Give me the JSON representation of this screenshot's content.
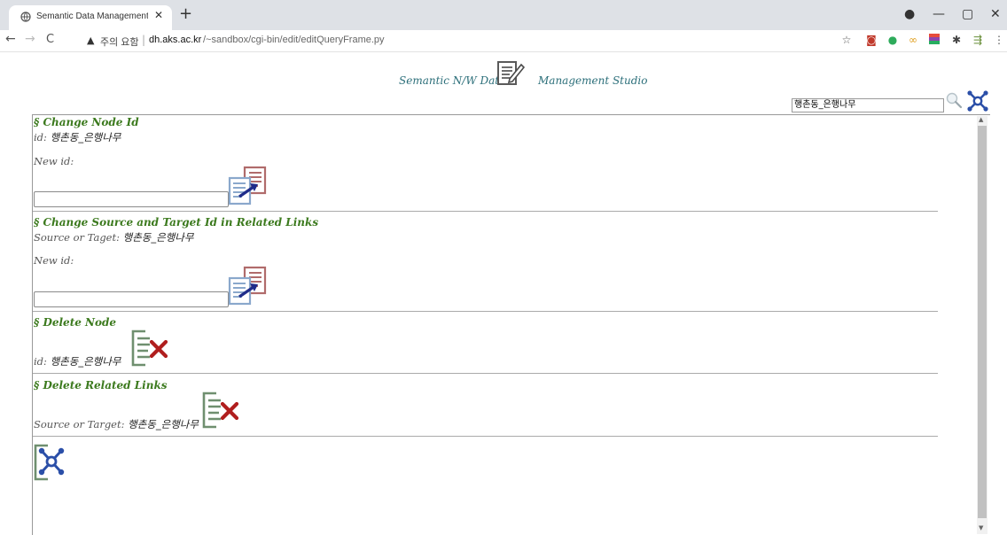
{
  "browser": {
    "tab_title": "Semantic Data Management St",
    "new_tab": "+",
    "address": {
      "security_label": "주의 요함",
      "separator": "|",
      "host": "dh.aks.ac.kr",
      "path": "/~sandbox/cgi-bin/edit/editQueryFrame.py"
    }
  },
  "header": {
    "title_left": "Semantic N/W Data",
    "title_right": "Management Studio",
    "search_value": "행촌동_은행나무"
  },
  "sections": {
    "change_node": {
      "title": "§ Change Node Id",
      "id_label": "id:",
      "id_value": "행촌동_은행나무",
      "new_id_label": "New id:",
      "new_id_value": ""
    },
    "change_links": {
      "title": "§ Change Source and Target Id in Related Links",
      "label": "Source or Taget:",
      "value": "행촌동_은행나무",
      "new_id_label": "New id:",
      "new_id_value": ""
    },
    "delete_node": {
      "title": "§ Delete Node",
      "id_label": "id:",
      "id_value": "행촌동_은행나무"
    },
    "delete_links": {
      "title": "§ Delete Related Links",
      "label": "Source or Target:",
      "value": "행촌동_은행나무"
    }
  },
  "colors": {
    "section_title": "#3c7a1e",
    "brand": "#2c6f7a",
    "delete_x": "#b01e1e",
    "graph_blue": "#2b4fa8"
  },
  "icons": [
    "edit-doc-icon",
    "search-icon",
    "graph-network-icon",
    "doc-transfer-icon",
    "delete-doc-icon"
  ]
}
